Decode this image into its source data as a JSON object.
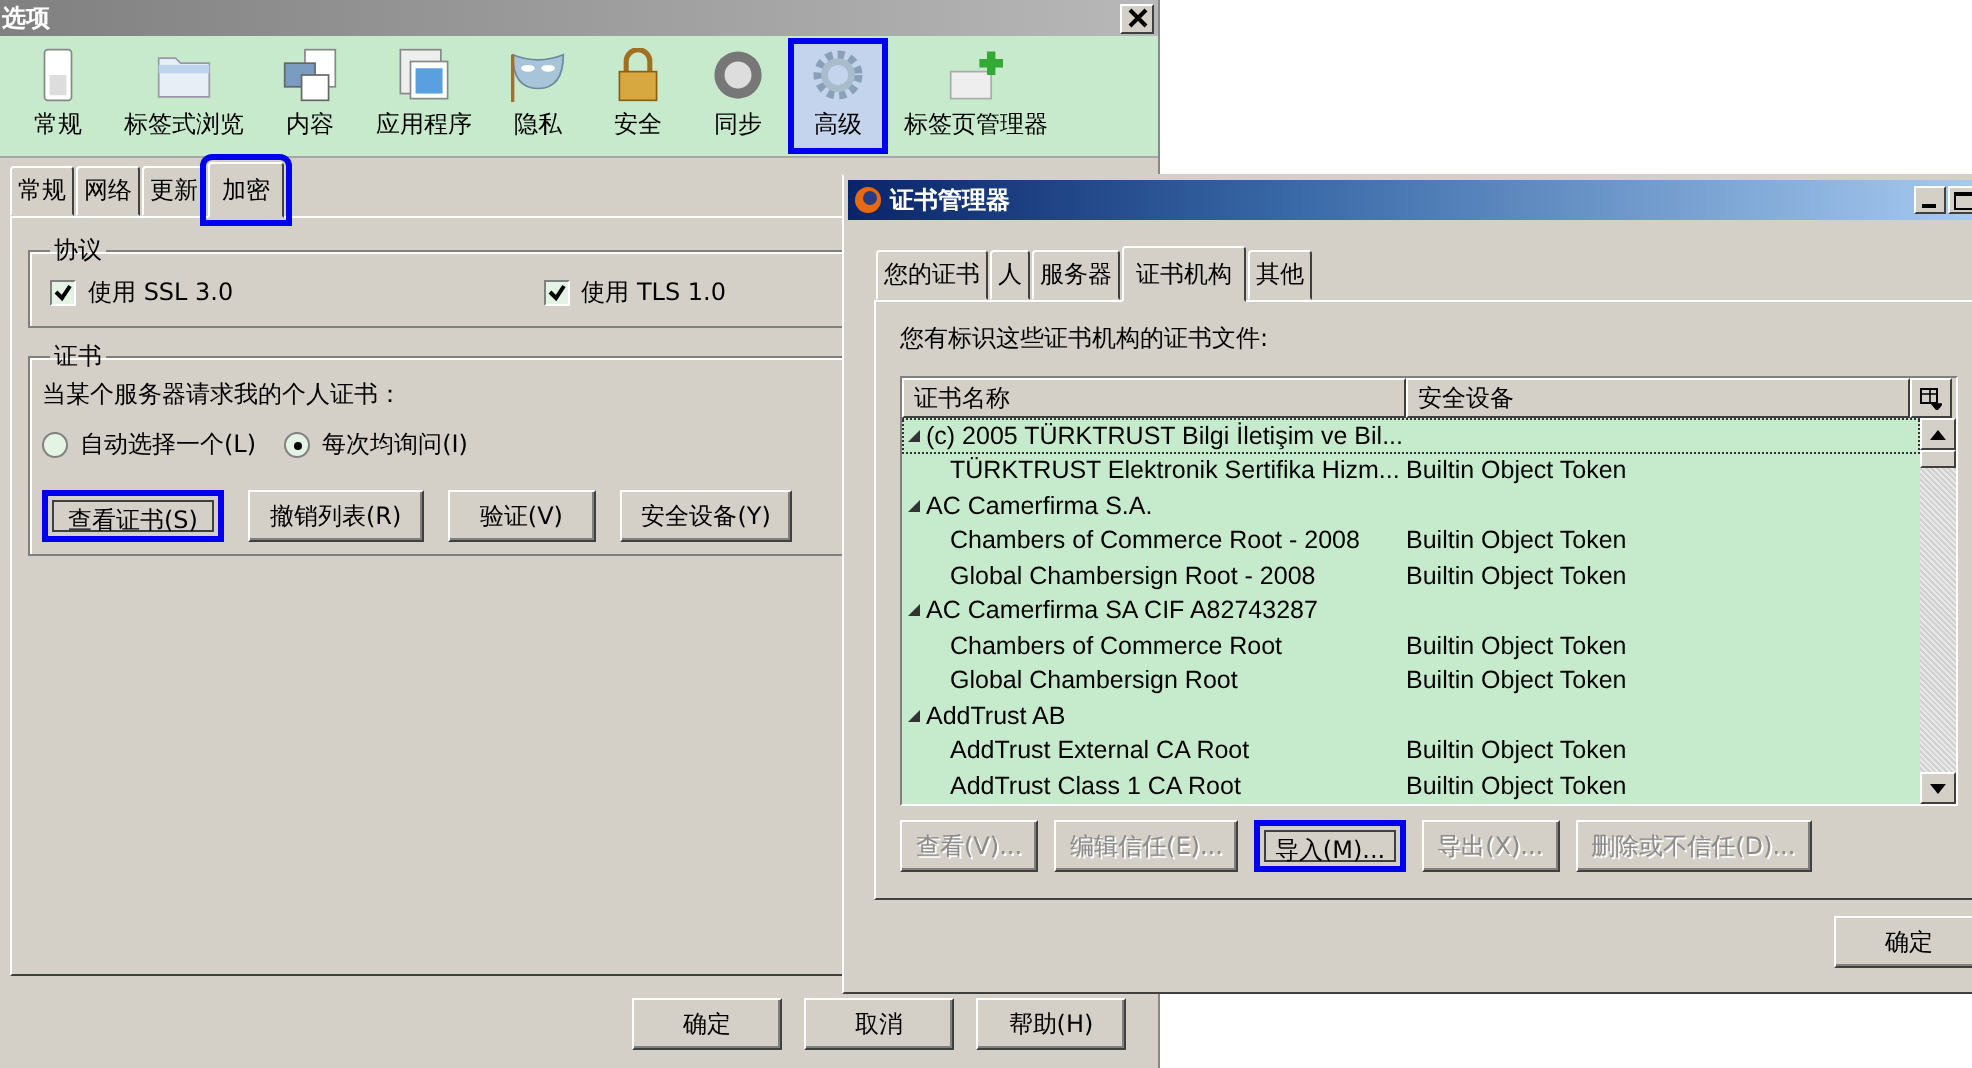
{
  "options_window": {
    "title": "选项",
    "toolbar": [
      {
        "label": "常规",
        "kind": "switch",
        "selected": false,
        "highlighted": false
      },
      {
        "label": "标签式浏览",
        "kind": "folder",
        "selected": false,
        "highlighted": false
      },
      {
        "label": "内容",
        "kind": "content",
        "selected": false,
        "highlighted": false
      },
      {
        "label": "应用程序",
        "kind": "apps",
        "selected": false,
        "highlighted": false
      },
      {
        "label": "隐私",
        "kind": "mask",
        "selected": false,
        "highlighted": false
      },
      {
        "label": "安全",
        "kind": "padlock",
        "selected": false,
        "highlighted": false
      },
      {
        "label": "同步",
        "kind": "sync",
        "selected": false,
        "highlighted": false
      },
      {
        "label": "高级",
        "kind": "gear",
        "selected": true,
        "highlighted": true
      },
      {
        "label": "标签页管理器",
        "kind": "tabplus",
        "selected": false,
        "highlighted": false
      }
    ],
    "tabs": [
      {
        "label": "常规",
        "selected": false,
        "highlighted": false
      },
      {
        "label": "网络",
        "selected": false,
        "highlighted": false
      },
      {
        "label": "更新",
        "selected": false,
        "highlighted": false
      },
      {
        "label": "加密",
        "selected": true,
        "highlighted": true
      }
    ],
    "protocols": {
      "title": "协议",
      "checkboxes": [
        {
          "label": "使用 SSL 3.0",
          "checked": true
        },
        {
          "label": "使用 TLS 1.0",
          "checked": true
        }
      ]
    },
    "certificates": {
      "title": "证书",
      "prompt": "当某个服务器请求我的个人证书：",
      "radios": [
        {
          "label": "自动选择一个(L)",
          "selected": false
        },
        {
          "label": "每次均询问(I)",
          "selected": true
        }
      ],
      "buttons": [
        {
          "label": "查看证书(S)",
          "highlighted": true
        },
        {
          "label": "撤销列表(R)",
          "highlighted": false
        },
        {
          "label": "验证(V)",
          "highlighted": false
        },
        {
          "label": "安全设备(Y)",
          "highlighted": false
        }
      ]
    },
    "footer_buttons": [
      "确定",
      "取消",
      "帮助(H)"
    ]
  },
  "cert_manager": {
    "title": "证书管理器",
    "tabs": [
      {
        "label": "您的证书",
        "selected": false
      },
      {
        "label": "人",
        "selected": false
      },
      {
        "label": "服务器",
        "selected": false
      },
      {
        "label": "证书机构",
        "selected": true
      },
      {
        "label": "其他",
        "selected": false
      }
    ],
    "description": "您有标识这些证书机构的证书文件:",
    "columns": [
      "证书名称",
      "安全设备"
    ],
    "groups": [
      {
        "name": "(c) 2005 TÜRKTRUST Bilgi İletişim ve Bil...",
        "expanded": true,
        "children": [
          {
            "name": "TÜRKTRUST Elektronik Sertifika Hizm...",
            "device": "Builtin Object Token"
          }
        ]
      },
      {
        "name": "AC Camerfirma S.A.",
        "expanded": true,
        "children": [
          {
            "name": "Chambers of Commerce Root - 2008",
            "device": "Builtin Object Token"
          },
          {
            "name": "Global Chambersign Root - 2008",
            "device": "Builtin Object Token"
          }
        ]
      },
      {
        "name": "AC Camerfirma SA CIF A82743287",
        "expanded": true,
        "children": [
          {
            "name": "Chambers of Commerce Root",
            "device": "Builtin Object Token"
          },
          {
            "name": "Global Chambersign Root",
            "device": "Builtin Object Token"
          }
        ]
      },
      {
        "name": "AddTrust AB",
        "expanded": true,
        "children": [
          {
            "name": "AddTrust External CA Root",
            "device": "Builtin Object Token"
          },
          {
            "name": "AddTrust Class 1 CA Root",
            "device": "Builtin Object Token"
          }
        ]
      }
    ],
    "buttons": [
      {
        "label": "查看(V)...",
        "disabled": true,
        "highlighted": false
      },
      {
        "label": "编辑信任(E)...",
        "disabled": true,
        "highlighted": false
      },
      {
        "label": "导入(M)...",
        "disabled": false,
        "highlighted": true
      },
      {
        "label": "导出(X)...",
        "disabled": true,
        "highlighted": false
      },
      {
        "label": "删除或不信任(D)...",
        "disabled": true,
        "highlighted": false
      }
    ],
    "ok_button": "确定"
  }
}
